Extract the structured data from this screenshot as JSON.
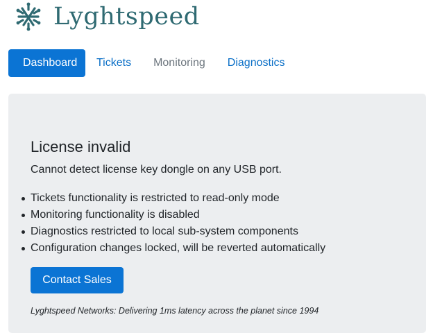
{
  "brand": {
    "name": "Lyghtspeed",
    "logo_icon": "knot-logo-icon",
    "color": "#2f6a72"
  },
  "nav": {
    "items": [
      {
        "label": "Dashboard",
        "state": "active"
      },
      {
        "label": "Tickets",
        "state": "link"
      },
      {
        "label": "Monitoring",
        "state": "disabled"
      },
      {
        "label": "Diagnostics",
        "state": "link"
      }
    ]
  },
  "alert": {
    "title": "License invalid",
    "message": "Cannot detect license key dongle on any USB port.",
    "restrictions": [
      "Tickets functionality is restricted to read-only mode",
      "Monitoring functionality is disabled",
      "Diagnostics restricted to local sub-system components",
      "Configuration changes locked, will be reverted automatically"
    ],
    "button_label": "Contact Sales",
    "footer": "Lyghtspeed Networks: Delivering 1ms latency across the planet since 1994"
  },
  "colors": {
    "primary": "#0b74d4",
    "link": "#0a6fc7",
    "muted": "#6c757d",
    "panel_bg": "#eceef0"
  }
}
